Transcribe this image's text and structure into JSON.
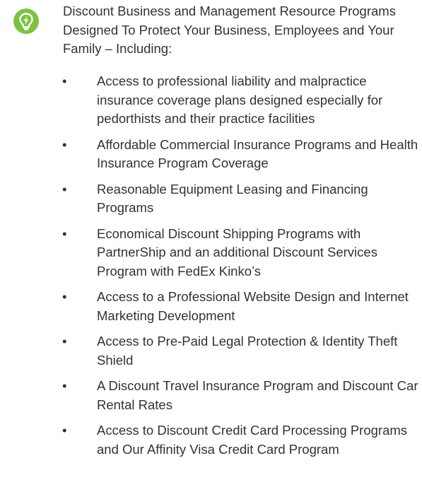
{
  "header": {
    "icon": "lightbulb-lightning-icon",
    "accent_color": "#7cc242",
    "intro_text": "Discount Business and Management Resource Programs Designed To Protect Your Business, Employees and Your Family  – Including:"
  },
  "list": {
    "bullet": "•",
    "items": [
      {
        "text": "Access to professional liability and malpractice insurance coverage plans designed especially for pedorthists and their practice facilities"
      },
      {
        "text": "Affordable Commercial Insurance Programs and Health Insurance Program Coverage"
      },
      {
        "text": "Reasonable Equipment Leasing and Financing Programs"
      },
      {
        "text": "Economical Discount Shipping Programs with PartnerShip and an additional Discount Services Program with FedEx Kinko’s"
      },
      {
        "text": "Access to a Professional Website Design and Internet Marketing Development"
      },
      {
        "text": "Access to Pre-Paid Legal Protection & Identity Theft Shield"
      },
      {
        "text": "A Discount Travel Insurance Program and Discount Car Rental Rates"
      },
      {
        "text": "Access to Discount Credit Card Processing Programs and Our Affinity Visa Credit Card Program"
      }
    ]
  }
}
